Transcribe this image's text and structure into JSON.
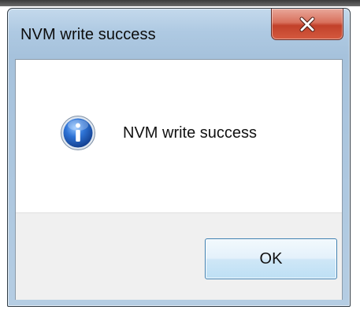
{
  "dialog": {
    "title": "NVM write success",
    "message": "NVM write success",
    "icon": "info-icon",
    "close_label": "X",
    "ok_label": "OK"
  },
  "colors": {
    "close_button": "#c2412a",
    "info_icon_blue": "#1f5fbf",
    "ok_button_border": "#3c7fb1"
  }
}
